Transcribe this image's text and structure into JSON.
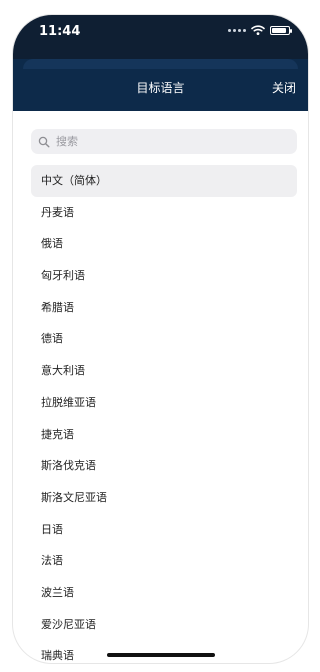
{
  "status_bar": {
    "time": "11:44"
  },
  "nav": {
    "title": "目标语言",
    "close_label": "关闭"
  },
  "search": {
    "placeholder": "搜索"
  },
  "languages": [
    "中文（简体）",
    "丹麦语",
    "俄语",
    "匈牙利语",
    "希腊语",
    "德语",
    "意大利语",
    "拉脱维亚语",
    "捷克语",
    "斯洛伐克语",
    "斯洛文尼亚语",
    "日语",
    "法语",
    "波兰语",
    "爱沙尼亚语",
    "瑞典语"
  ],
  "selected_index": 0,
  "colors": {
    "nav_background": "#0d2a4a",
    "status_background": "#0f1f33",
    "selected_row": "#efeff1"
  },
  "icons": [
    "search-icon",
    "wifi-icon",
    "battery-icon",
    "signal-icon"
  ]
}
